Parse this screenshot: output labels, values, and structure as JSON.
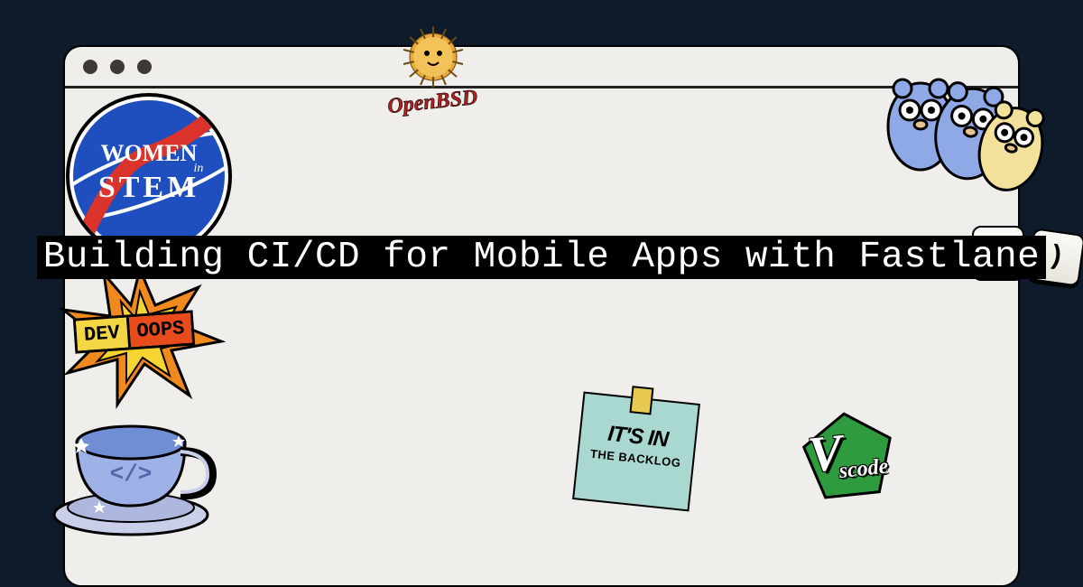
{
  "headline": "Building CI/CD for Mobile Apps with Fastlane",
  "stickers": {
    "stem_badge": {
      "line1": "WOMEN",
      "line2": "in",
      "line3": "STEM"
    },
    "devoops": {
      "left": "DEV",
      "right": "OOPS"
    },
    "openbsd": "OpenBSD",
    "backlog": {
      "line1": "IT'S IN",
      "line2": "THE BACKLOG"
    },
    "vscode": {
      "big": "V",
      "small": "scode"
    },
    "keys": {
      "k1": ":",
      "k2": ")"
    }
  },
  "colors": {
    "bg": "#0d1b2a",
    "window": "#f0eeea",
    "headline_bg": "#000000",
    "headline_fg": "#ffffff",
    "stem_blue": "#1f4fbf",
    "devoops_yellow": "#f4d544",
    "devoops_orange": "#e84b1c",
    "backlog_teal": "#a8d8d0",
    "vscode_green": "#2e9b3f"
  }
}
